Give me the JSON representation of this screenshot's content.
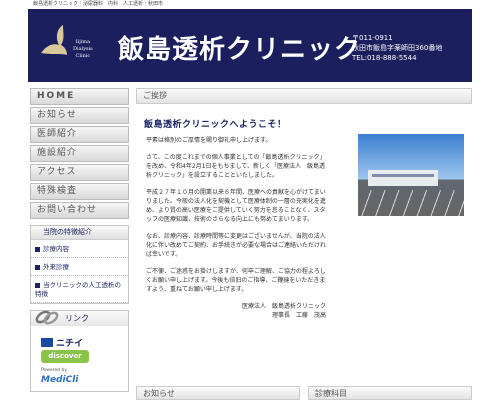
{
  "topbar": {
    "text": "飯島透析クリニック｜泌尿器科　内科　人工透析｜秋田市"
  },
  "header": {
    "logo_en_line1": "Iijima",
    "logo_en_line2": "Dialysis",
    "logo_en_line3": "Clinic",
    "clinic_name": "飯島透析クリニック",
    "postal": "〒011-0911",
    "address": "秋田市飯島字薬師田360番地",
    "tel": "TEL:018-888-5544"
  },
  "nav": {
    "home": "HOME",
    "news": "お知らせ",
    "doctors": "医師紹介",
    "facility": "施設紹介",
    "access": "アクセス",
    "exam": "特殊検査",
    "contact": "お問い合わせ"
  },
  "features": {
    "title": "当院の特徴紹介",
    "items": [
      "診療内容",
      "外来診療",
      "当クリニックの人工透析の特徴"
    ]
  },
  "links": {
    "title": "リンク",
    "nichii": "ニチイ",
    "discover": "discover",
    "powered": "Powered by",
    "medi": "MediCli"
  },
  "main": {
    "greeting_header": "ご挨拶",
    "welcome": "飯島透析クリニックへようこそ！",
    "p1": "平素は格別のご厚情を賜り御礼申し上げます。",
    "p2": "さて、この度これまでの個人事業としての「飯島透析クリニック」を改め、令和4年2月1日をもちまして、新しく「医療法人　飯島透析クリニック」を設立することといたしました。",
    "p3": "平成２７年１０月の開業以来６年間、医療への貢献を心がけてまいりました。今般の法人化を契機として医療体制の一層の充実化を進め、より質の高い医療をご提供していく努力を怠ることなく、スタッフの医療知識、技術のさらなる向上にも努めてまいります。",
    "p4": "なお、診療内容、診療時間等に変更はございませんが、当院の法人化に伴い改めてご契約、お手続きが必要な場合はご連絡いただければ幸いです。",
    "p5": "ご不便、ご迷惑をお掛けしますが、何卒ご理解、ご協力の程よろしくお願い申し上げます。今後も倍旧のご指導、ご鞭撻をいただきますよう、重ねてお願い申し上げます。",
    "sign1": "医療法人　飯島透析クリニック",
    "sign2": "理事長　工藤　茂高"
  },
  "bottom": {
    "news": "お知らせ",
    "departments": "診療科目"
  },
  "colors": {
    "navy": "#1b1f5e",
    "accent": "#1c2466"
  }
}
